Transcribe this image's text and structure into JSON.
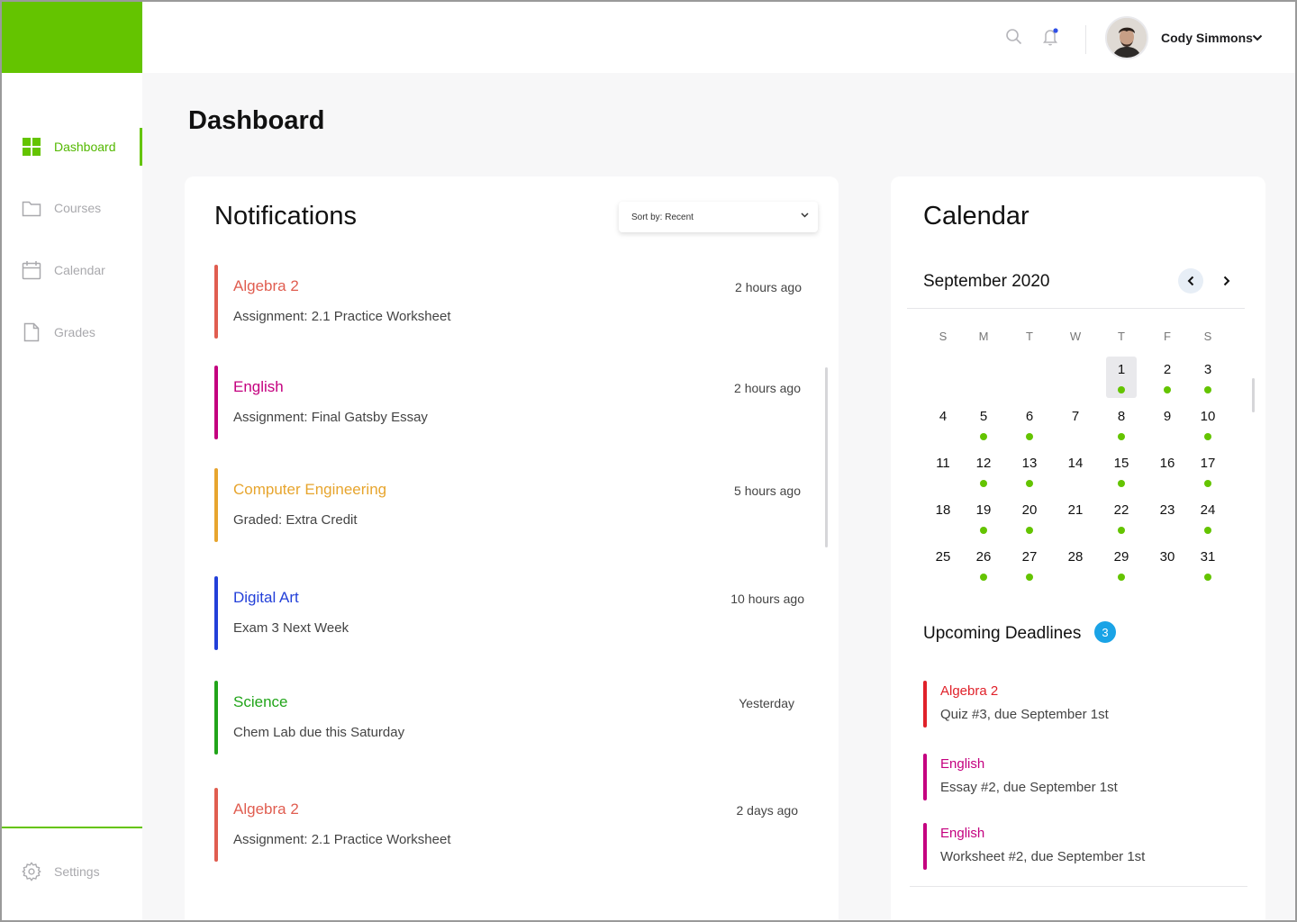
{
  "colors": {
    "brand_green": "#64c400",
    "algebra": "#e05d50",
    "english": "#c4007f",
    "computer_engineering": "#e7a52e",
    "digital_art": "#2340d9",
    "science": "#22a51a",
    "deadline_red": "#e0212a",
    "badge_blue": "#1aa3e6"
  },
  "sidebar": {
    "items": [
      {
        "label": "Dashboard",
        "icon": "dashboard-grid-icon",
        "active": true
      },
      {
        "label": "Courses",
        "icon": "folder-icon",
        "active": false
      },
      {
        "label": "Calendar",
        "icon": "calendar-icon",
        "active": false
      },
      {
        "label": "Grades",
        "icon": "document-icon",
        "active": false
      }
    ],
    "settings_label": "Settings",
    "settings_icon": "gear-icon"
  },
  "header": {
    "search_icon": "search-icon",
    "bell_icon": "bell-icon",
    "user_name": "Cody Simmons",
    "caret_icon": "chevron-down-icon"
  },
  "page_title": "Dashboard",
  "notifications": {
    "title": "Notifications",
    "sort_label": "Sort by: Recent",
    "items": [
      {
        "course": "Algebra 2",
        "detail": "Assignment: 2.1 Practice Worksheet",
        "time": "2 hours ago",
        "color": "#e05d50"
      },
      {
        "course": "English",
        "detail": "Assignment: Final Gatsby Essay",
        "time": "2 hours ago",
        "color": "#c4007f"
      },
      {
        "course": "Computer Engineering",
        "detail": "Graded: Extra Credit",
        "time": "5 hours ago",
        "color": "#e7a52e"
      },
      {
        "course": "Digital Art",
        "detail": "Exam 3 Next Week",
        "time": "10 hours ago",
        "color": "#2340d9"
      },
      {
        "course": "Science",
        "detail": "Chem Lab due this Saturday",
        "time": "Yesterday",
        "color": "#22a51a"
      },
      {
        "course": "Algebra 2",
        "detail": "Assignment: 2.1 Practice Worksheet",
        "time": "2 days ago",
        "color": "#e05d50"
      }
    ]
  },
  "calendar": {
    "title": "Calendar",
    "month": "September 2020",
    "weekdays": [
      "S",
      "M",
      "T",
      "W",
      "T",
      "F",
      "S"
    ],
    "today": 1,
    "days_with_events": [
      1,
      2,
      3,
      5,
      6,
      8,
      10,
      12,
      13,
      15,
      17,
      19,
      20,
      22,
      24,
      26,
      27,
      29,
      31
    ],
    "weeks": [
      [
        "",
        "",
        "",
        "",
        "1",
        "2",
        "3"
      ],
      [
        "4",
        "5",
        "6",
        "7",
        "8",
        "9",
        "10"
      ],
      [
        "11",
        "12",
        "13",
        "14",
        "15",
        "16",
        "17"
      ],
      [
        "18",
        "19",
        "20",
        "21",
        "22",
        "23",
        "24"
      ],
      [
        "25",
        "26",
        "27",
        "28",
        "29",
        "30",
        "31"
      ]
    ]
  },
  "deadlines": {
    "title": "Upcoming Deadlines",
    "count": "3",
    "items": [
      {
        "course": "Algebra 2",
        "detail": "Quiz #3, due September 1st",
        "color": "#e0212a"
      },
      {
        "course": "English",
        "detail": "Essay #2, due September 1st",
        "color": "#c4007f"
      },
      {
        "course": "English",
        "detail": "Worksheet #2, due September 1st",
        "color": "#c4007f"
      }
    ]
  }
}
